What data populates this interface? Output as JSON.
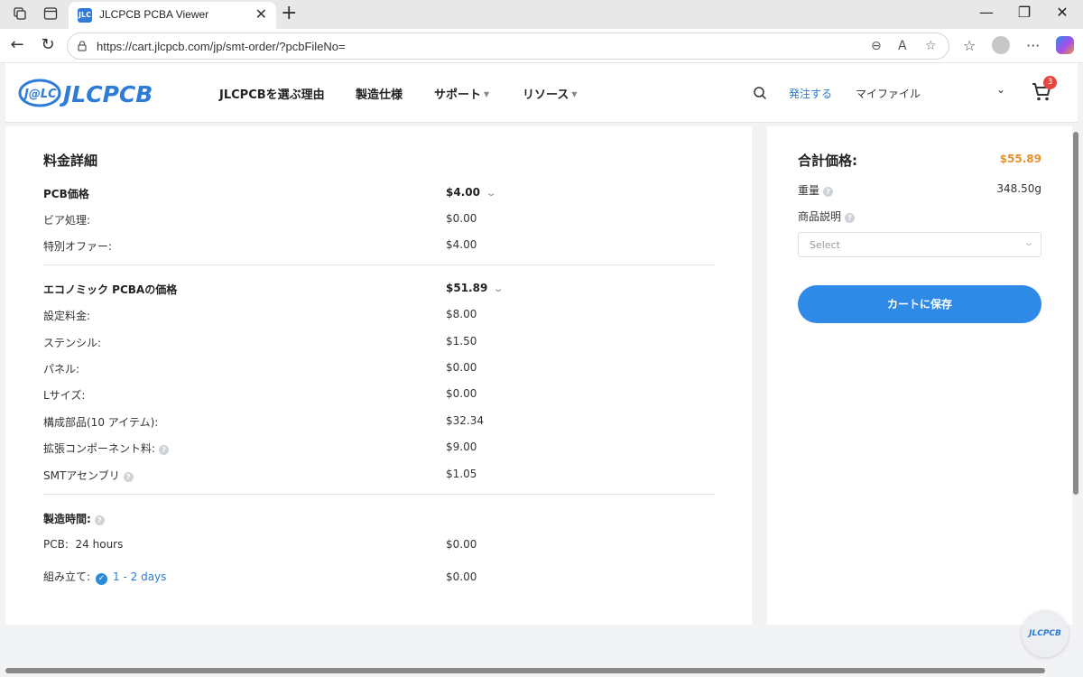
{
  "browser": {
    "tab_title": "JLCPCB PCBA Viewer",
    "tab_favicon_text": "JLC",
    "url": "https://cart.jlcpcb.com/jp/smt-order/?pcbFileNo=",
    "icons": [
      "back-icon",
      "refresh-icon",
      "lock-icon",
      "zoom-icon",
      "read-aloud-icon",
      "favorite-icon",
      "favorites-list-icon",
      "more-icon"
    ]
  },
  "site": {
    "logo_text": "JLCPCB",
    "logo_badge": "J@LC",
    "nav": [
      {
        "label": "JLCPCBを選ぶ理由"
      },
      {
        "label": "製造仕様"
      },
      {
        "label": "サポート"
      },
      {
        "label": "リソース"
      }
    ],
    "order_link": "発注する",
    "my_file": "マイファイル",
    "cart_count": "3"
  },
  "price_details": {
    "title": "料金詳細",
    "pcb": {
      "label": "PCB価格",
      "value": "$4.00",
      "rows": [
        {
          "label": "ビア処理:",
          "value": "$0.00"
        },
        {
          "label": "特別オファー:",
          "value": "$4.00"
        }
      ]
    },
    "pcba": {
      "label": "エコノミック PCBAの価格",
      "value": "$51.89",
      "rows": [
        {
          "label": "設定料金:",
          "value": "$8.00"
        },
        {
          "label": "ステンシル:",
          "value": "$1.50"
        },
        {
          "label": "パネル:",
          "value": "$0.00"
        },
        {
          "label": "Lサイズ:",
          "value": "$0.00"
        },
        {
          "label": "構成部品(10 アイテム):",
          "value": "$32.34"
        },
        {
          "label": "拡張コンポーネント料:",
          "value": "$9.00"
        },
        {
          "label": "SMTアセンブリ",
          "value": "$1.05"
        }
      ]
    },
    "build_time": {
      "label": "製造時間:",
      "pcb_label": "PCB:",
      "pcb_time": "24 hours",
      "pcb_value": "$0.00",
      "assembly_label": "組み立て:",
      "assembly_time": "1 - 2 days",
      "assembly_value": "$0.00"
    }
  },
  "summary": {
    "total_label": "合計価格:",
    "total_value": "$55.89",
    "weight_label": "重量",
    "weight_value": "348.50g",
    "description_label": "商品説明",
    "select_placeholder": "Select",
    "save_button": "カートに保存"
  },
  "floating_logo": "JLCPCB",
  "colors": {
    "accent_blue": "#2f89e6",
    "price_orange": "#e8902c",
    "cart_badge_red": "#e8453c"
  }
}
